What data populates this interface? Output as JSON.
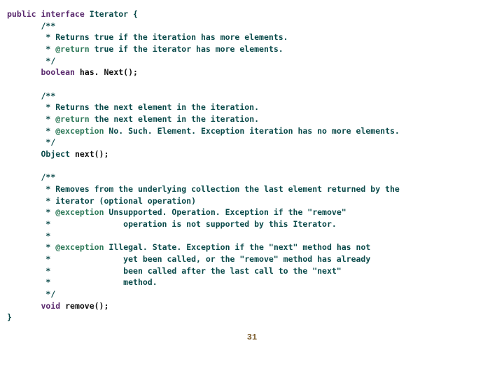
{
  "code": {
    "has_next": {
      "c0": "/**",
      "c1": " * Returns true if the iteration has more elements.",
      "c2_tag": " @return",
      "c2_rest": " true if the iterator has more elements.",
      "c3": " */",
      "ret_kw": "boolean",
      "name": " has. Next();"
    },
    "next": {
      "c0": "/**",
      "c1": " * Returns the next element in the iteration.",
      "c2_tag": " @return",
      "c2_rest": " the next element in the iteration.",
      "c3_tag": " @exception",
      "c3_rest": " No. Such. Element. Exception iteration has no more elements.",
      "c4": " */",
      "ret_kw": "Object",
      "name": " next();"
    },
    "remove": {
      "c0": "/**",
      "c1": " * Removes from the underlying collection the last element returned by the",
      "c2": " * iterator (optional operation)",
      "c3_tag": " @exception",
      "c3_rest": " Unsupported. Operation. Exception if the \"remove\"",
      "c4": " *               operation is not supported by this Iterator.",
      "c5": " *",
      "c6_tag": " @exception",
      "c6_rest": " Illegal. State. Exception if the \"next\" method has not",
      "c7": " *               yet been called, or the \"remove\" method has already",
      "c8": " *               been called after the last call to the \"next\"",
      "c9": " *               method.",
      "c10": " */",
      "ret_kw": "void",
      "name": " remove();"
    },
    "decl": {
      "kw_public": "public",
      "kw_interface": " interface ",
      "name": "Iterator",
      "open": " {",
      "close": "}"
    }
  },
  "page_number": "31"
}
